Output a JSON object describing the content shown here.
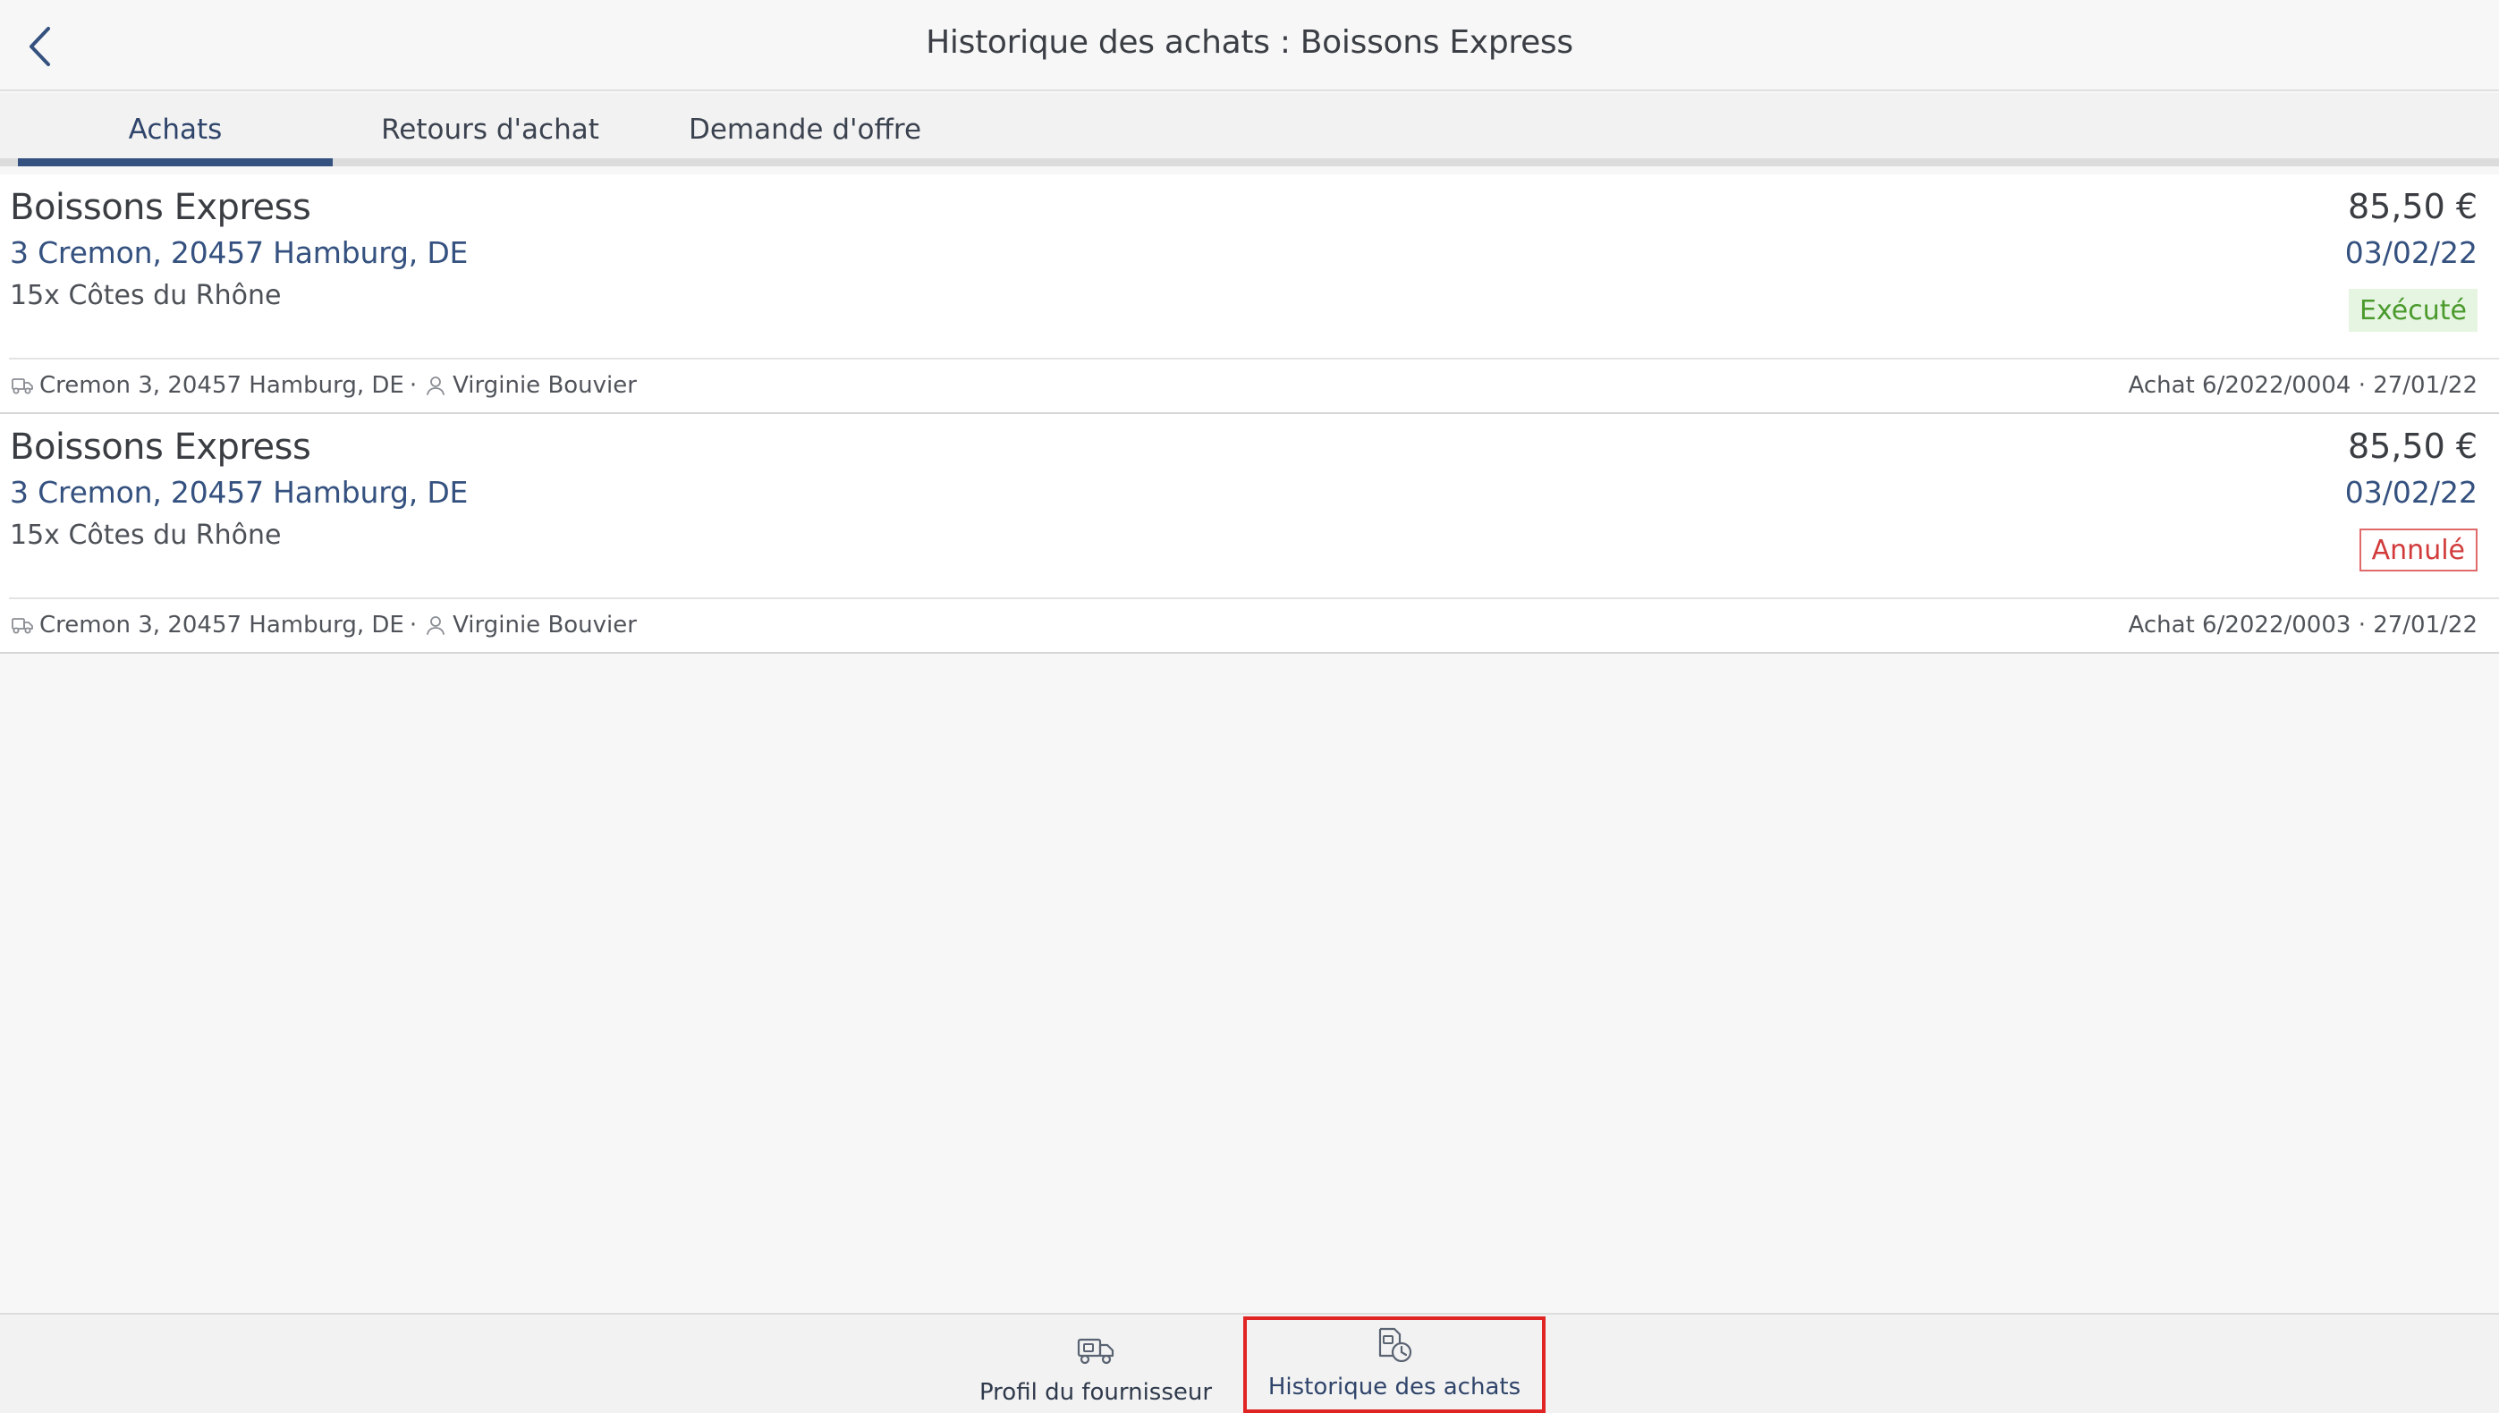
{
  "header": {
    "title": "Historique des achats : Boissons Express",
    "back_icon": "chevron-left-icon"
  },
  "tabs": [
    {
      "label": "Achats",
      "active": true
    },
    {
      "label": "Retours d'achat",
      "active": false
    },
    {
      "label": "Demande d'offre",
      "active": false
    }
  ],
  "purchases": [
    {
      "supplier": "Boissons Express",
      "address": "3 Cremon, 20457 Hamburg, DE",
      "items": "15x Côtes du Rhône",
      "amount": "85,50 €",
      "date": "03/02/22",
      "status": "Exécuté",
      "status_color": "#4a9a2c",
      "delivery_address": "Cremon 3, 20457 Hamburg, DE",
      "contact": "Virginie Bouvier",
      "reference": "Achat 6/2022/0004 · 27/01/22"
    },
    {
      "supplier": "Boissons Express",
      "address": "3 Cremon, 20457 Hamburg, DE",
      "items": "15x Côtes du Rhône",
      "amount": "85,50 €",
      "date": "03/02/22",
      "status": "Annulé",
      "status_color": "#d23b3b",
      "delivery_address": "Cremon 3, 20457 Hamburg, DE",
      "contact": "Virginie Bouvier",
      "reference": "Achat 6/2022/0003 · 27/01/22"
    }
  ],
  "bottom_nav": [
    {
      "label": "Profil du fournisseur",
      "icon": "truck-icon",
      "active": false
    },
    {
      "label": "Historique des achats",
      "icon": "history-icon",
      "active": true
    }
  ],
  "colors": {
    "accent": "#34517f",
    "highlight_border": "#e02424"
  }
}
